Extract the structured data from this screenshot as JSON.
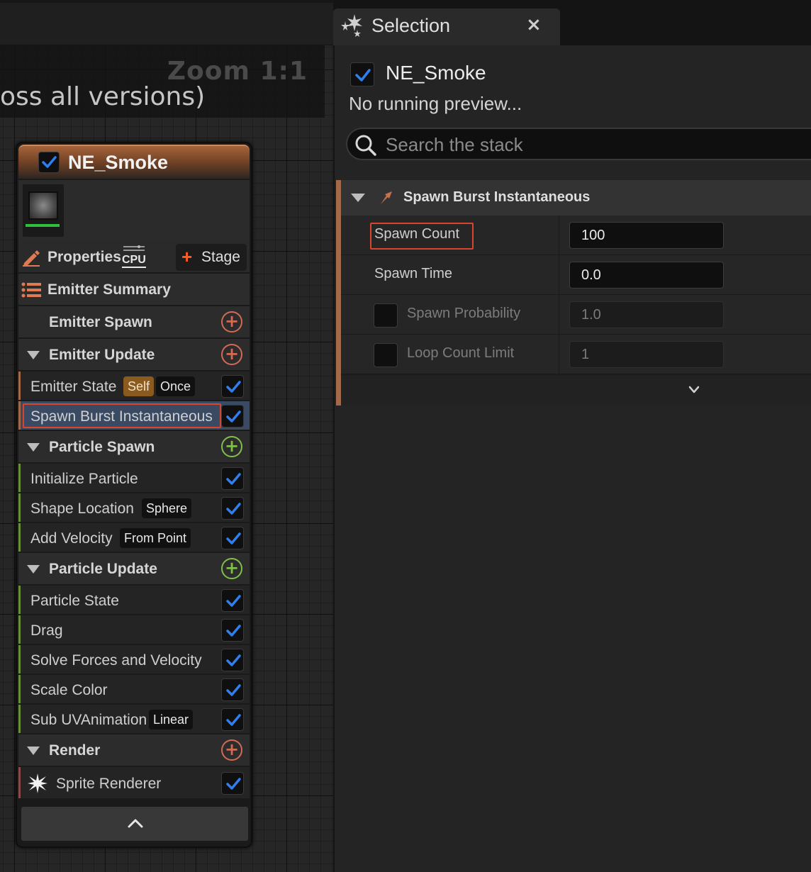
{
  "graph": {
    "zoom_label": "Zoom 1:1",
    "comment_text": "oss all versions)"
  },
  "node": {
    "title": "NE_Smoke",
    "enabled": true,
    "properties_label": "Properties",
    "cpu_badge": "CPU",
    "stage_button": "Stage",
    "emitter_summary": "Emitter Summary",
    "sections": {
      "emitter_spawn": "Emitter Spawn",
      "emitter_update": "Emitter Update",
      "particle_spawn": "Particle Spawn",
      "particle_update": "Particle Update",
      "render": "Render"
    },
    "modules": {
      "emitter_state": {
        "label": "Emitter State",
        "tag1": "Self",
        "tag2": "Once"
      },
      "spawn_burst": {
        "label": "Spawn Burst Instantaneous"
      },
      "initialize_particle": {
        "label": "Initialize Particle"
      },
      "shape_location": {
        "label": "Shape Location",
        "tag": "Sphere"
      },
      "add_velocity": {
        "label": "Add Velocity",
        "tag": "From Point"
      },
      "particle_state": {
        "label": "Particle State"
      },
      "drag": {
        "label": "Drag"
      },
      "solve_forces": {
        "label": "Solve Forces and Velocity"
      },
      "scale_color": {
        "label": "Scale Color"
      },
      "sub_uv": {
        "label": "Sub UVAnimation",
        "tag": "Linear"
      },
      "sprite_renderer": {
        "label": "Sprite Renderer"
      }
    }
  },
  "panel": {
    "tab_title": "Selection",
    "tab_close": "×",
    "title": "NE_Smoke",
    "status": "No running preview...",
    "search_placeholder": "Search the stack",
    "stack": {
      "title": "Spawn Burst Instantaneous",
      "rows": [
        {
          "name": "Spawn Count",
          "value": "100"
        },
        {
          "name": "Spawn Time",
          "value": "0.0"
        },
        {
          "name": "Spawn Probability",
          "value": "1.0"
        },
        {
          "name": "Loop Count Limit",
          "value": "1"
        }
      ]
    }
  },
  "colors": {
    "accent_orange": "#a36a4a",
    "emitter_green": "#6a8f3a",
    "render_red": "#8a4a4a",
    "check_blue": "#2f7ff0",
    "highlight_red": "#d9452f"
  }
}
